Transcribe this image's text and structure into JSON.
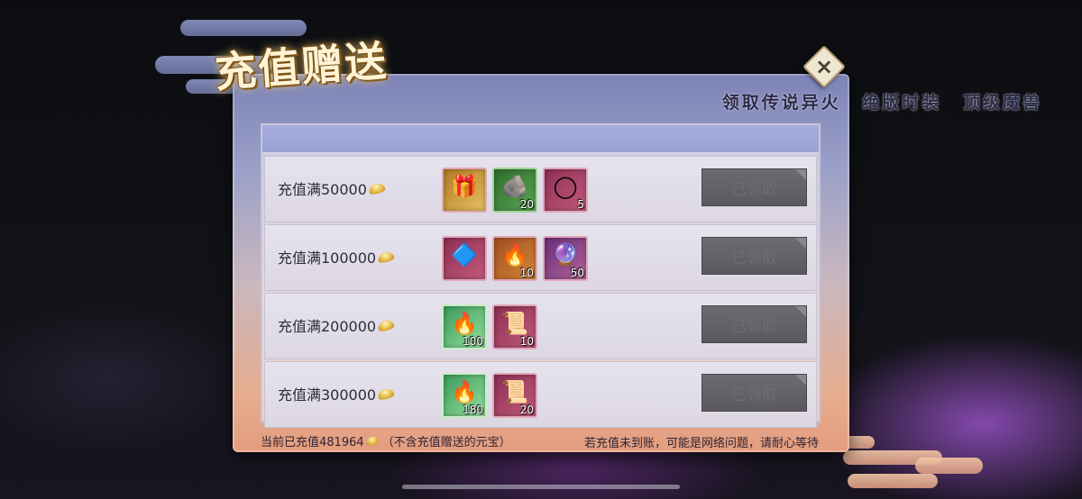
{
  "window": {
    "title": "充值赠送",
    "subtitle": "领取传说异火 绝版时装 顶级魔兽",
    "close_glyph": "×"
  },
  "rewards": [
    {
      "label": "充值满50000",
      "items": [
        {
          "icon": "gift-chest-icon",
          "glyph": "🎁",
          "count": "",
          "style": "bg-gold"
        },
        {
          "icon": "ore-stone-icon",
          "glyph": "🪨",
          "count": "20",
          "style": "bg-green"
        },
        {
          "icon": "ring-icon",
          "glyph": "◯",
          "count": "5",
          "style": "bg-rose"
        }
      ],
      "button": "已领取"
    },
    {
      "label": "充值满100000",
      "items": [
        {
          "icon": "crystal-shard-icon",
          "glyph": "🔷",
          "count": "",
          "style": "bg-rose"
        },
        {
          "icon": "blue-flame-icon",
          "glyph": "🔥",
          "count": "10",
          "style": "bg-orange"
        },
        {
          "icon": "purple-orb-icon",
          "glyph": "🔮",
          "count": "50",
          "style": "bg-purple"
        }
      ],
      "button": "已领取"
    },
    {
      "label": "充值满200000",
      "items": [
        {
          "icon": "green-flame-icon",
          "glyph": "🔥",
          "count": "100",
          "style": "bg-mint"
        },
        {
          "icon": "scroll-icon",
          "glyph": "📜",
          "count": "10",
          "style": "bg-rose"
        }
      ],
      "button": "已领取"
    },
    {
      "label": "充值满300000",
      "items": [
        {
          "icon": "green-flame-icon",
          "glyph": "🔥",
          "count": "180",
          "style": "bg-mint"
        },
        {
          "icon": "scroll-icon",
          "glyph": "📜",
          "count": "20",
          "style": "bg-rose"
        }
      ],
      "button": "已领取"
    }
  ],
  "footer": {
    "current_prefix": "当前已充值481964",
    "current_suffix": "（不含充值赠送的元宝）",
    "notice": "若充值未到账，可能是网络问题，请耐心等待"
  }
}
